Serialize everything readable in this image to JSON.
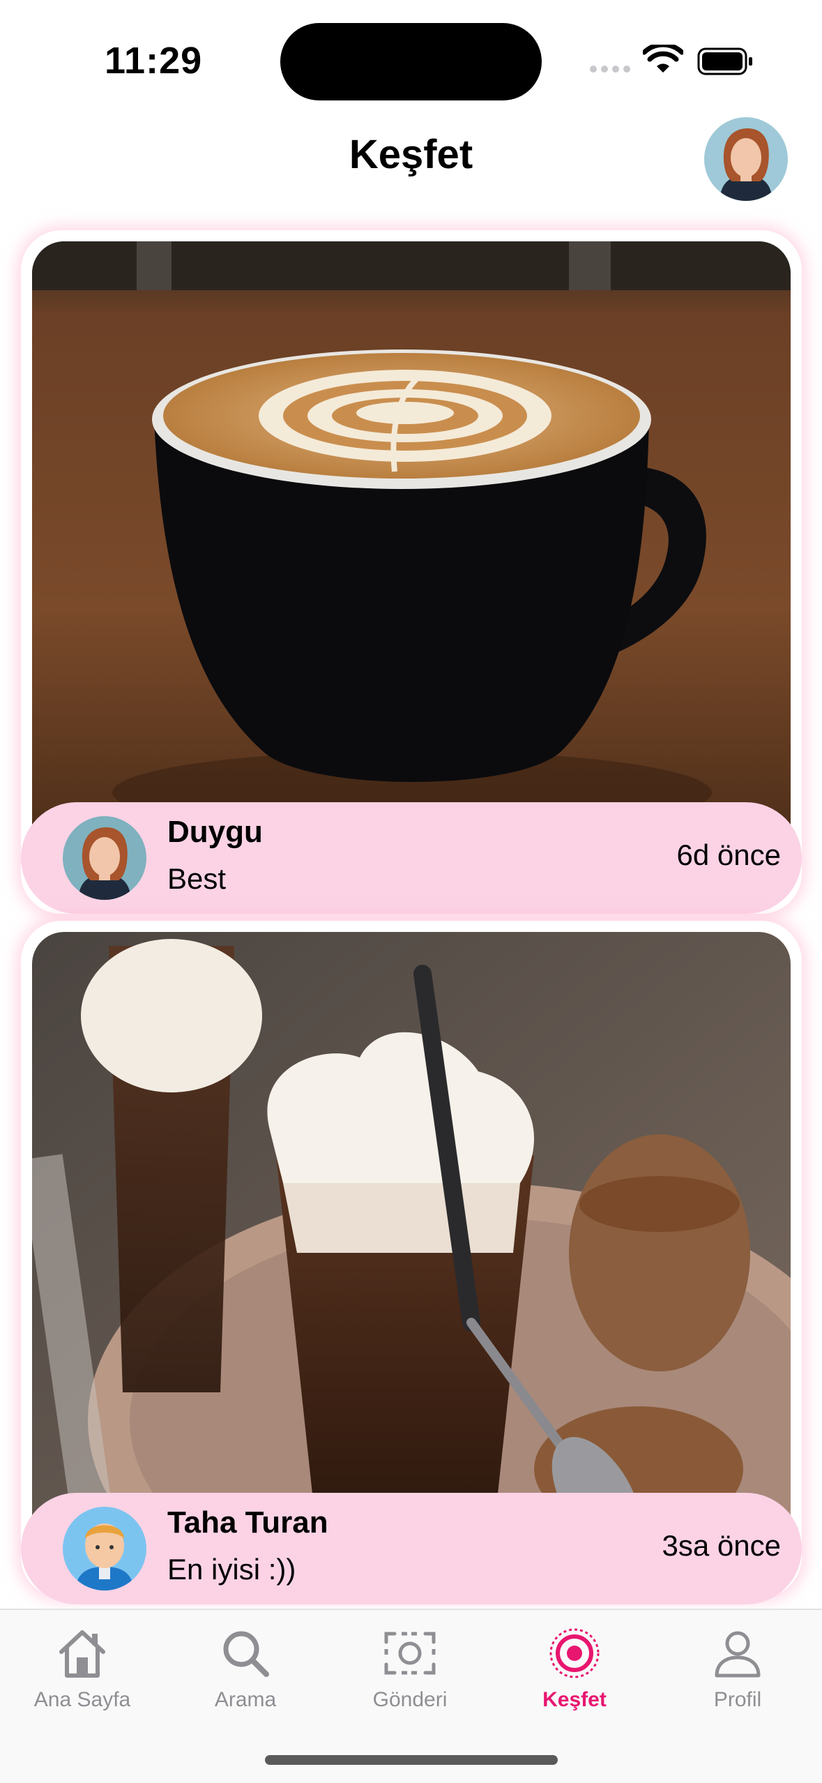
{
  "status_bar": {
    "time": "11:29"
  },
  "header": {
    "title": "Keşfet"
  },
  "posts": [
    {
      "author": "Duygu",
      "caption": "Best",
      "time_ago": "6d önce",
      "image": "latte-art-coffee-photo"
    },
    {
      "author": "Taha Turan",
      "caption": "En iyisi :))",
      "time_ago": "3sa önce",
      "image": "whipped-cream-coffee-photo"
    }
  ],
  "tab_bar": {
    "tabs": [
      {
        "label": "Ana Sayfa",
        "icon": "house-icon"
      },
      {
        "label": "Arama",
        "icon": "magnifier-icon"
      },
      {
        "label": "Gönderi",
        "icon": "camera-frame-icon"
      },
      {
        "label": "Keşfet",
        "icon": "target-icon",
        "active": true
      },
      {
        "label": "Profil",
        "icon": "person-icon"
      }
    ]
  },
  "colors": {
    "accent": "#e8166f",
    "card_footer": "#fbd3e5",
    "inactive": "#8e8e93"
  }
}
